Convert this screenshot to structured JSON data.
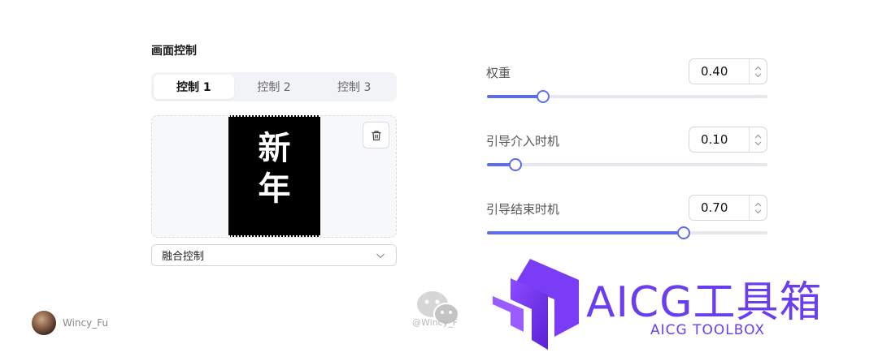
{
  "section": {
    "title": "画面控制"
  },
  "tabs": [
    {
      "label": "控制 1",
      "active": true
    },
    {
      "label": "控制 2",
      "active": false
    },
    {
      "label": "控制 3",
      "active": false
    }
  ],
  "preview": {
    "chars": [
      "新",
      "年"
    ]
  },
  "mode_select": {
    "value": "融合控制"
  },
  "sliders": [
    {
      "label": "权重",
      "value": "0.40",
      "fraction": 0.2
    },
    {
      "label": "引导介入时机",
      "value": "0.10",
      "fraction": 0.1
    },
    {
      "label": "引导结束时机",
      "value": "0.70",
      "fraction": 0.7
    }
  ],
  "footer": {
    "author": "Wincy_Fu",
    "watermark": "@Wincy_F",
    "brand_cn": "AICG工具箱",
    "brand_en": "AICG TOOLBOX"
  },
  "colors": {
    "accent": "#5b6cf5",
    "brand": "#6b3df0"
  },
  "icons": {
    "delete": "trash-icon",
    "dropdown": "chevron-down-icon",
    "spin": "stepper-icon"
  }
}
